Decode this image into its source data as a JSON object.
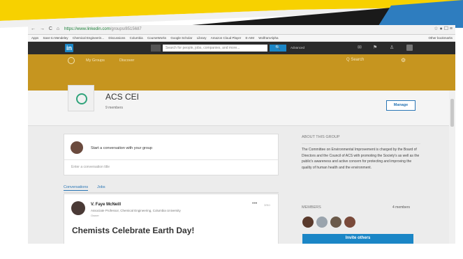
{
  "browser": {
    "url_host": "https://www.linkedin.com",
    "url_path": "/groups/8515687",
    "nav_icons": "←  →  C  ⌂",
    "right_icons": "☆  ●  ☐  ≡"
  },
  "bookmarks": {
    "items": [
      "Apps",
      "Save to Mendeley",
      "Chemical Engineerin...",
      "Discussions",
      "Columbia",
      "CourseWorks",
      "Google Scholar",
      "Library",
      "Amazon Cloud Player",
      "E-AIM",
      "WolframAlpha"
    ],
    "right": "Other bookmarks"
  },
  "linkedin": {
    "logo": "in",
    "search_placeholder": "Search for people, jobs, companies, and more...",
    "search_button": "🔍",
    "advanced": "Advanced"
  },
  "group_nav": {
    "my_groups": "My Groups",
    "discover": "Discover",
    "search": "Q  Search",
    "gear": "⚙"
  },
  "group": {
    "name": "ACS CEI",
    "members": "9 members",
    "manage": "Manage"
  },
  "composer": {
    "prompt": "Start a conversation with your group",
    "title_placeholder": "Enter a conversation title"
  },
  "tabs": [
    "Conversations",
    "Jobs"
  ],
  "conversation": {
    "author": "V. Faye McNeill",
    "role": "Associate Professor, Chemical Engineering, Columbia University",
    "meta": "Owner",
    "more": "•••",
    "time": "1mo",
    "headline": "Chemists Celebrate Earth Day!"
  },
  "about": {
    "title": "ABOUT THIS GROUP",
    "text": "The Committee on Environmental Improvement is charged by the Board of Directors and the Council of ACS with promoting the Society's as well as the public's awareness and active concern for protecting and improving the quality of human health and the environment."
  },
  "members_panel": {
    "title": "MEMBERS",
    "count": "4 members",
    "invite": "Invite others"
  },
  "colors": {
    "linkedin_blue": "#1b86c6",
    "gold": "#c6951f",
    "header_dark": "#2b2b2b"
  }
}
